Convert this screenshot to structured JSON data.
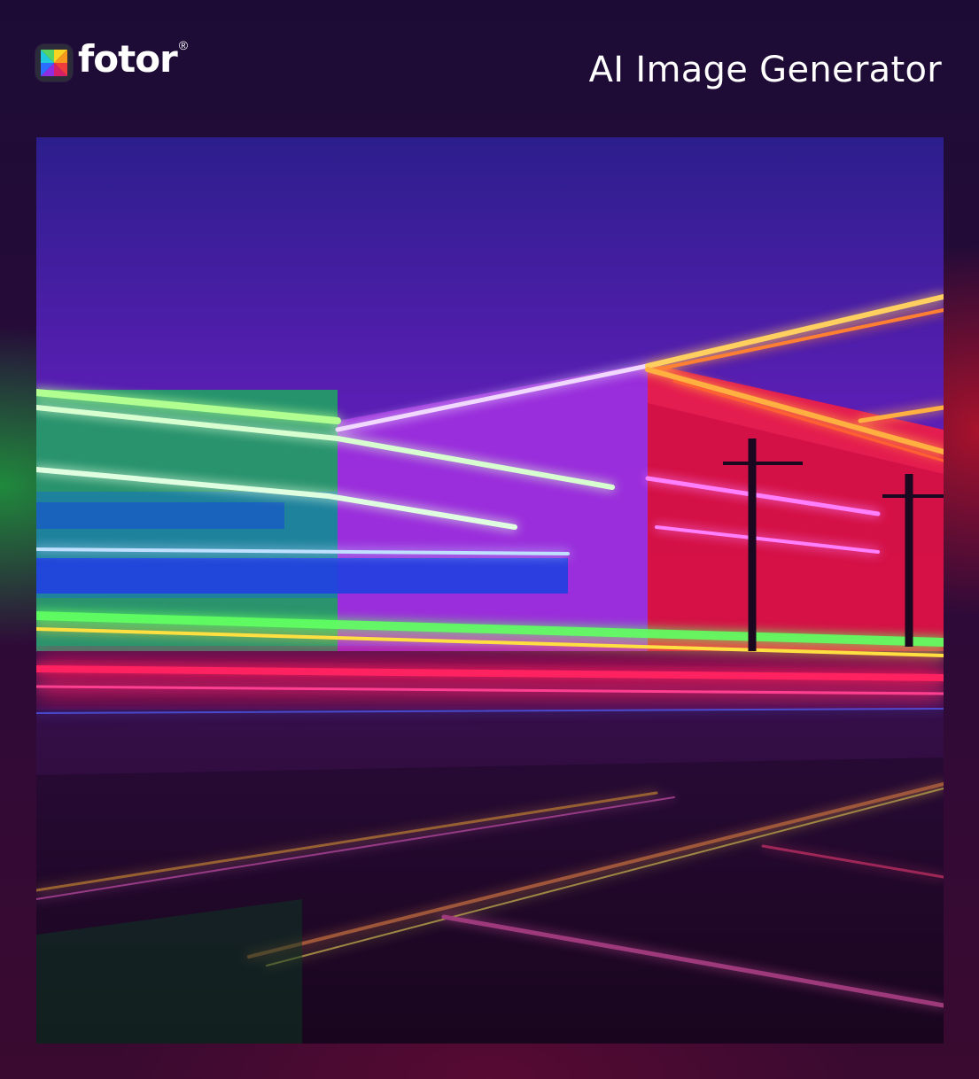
{
  "brand": {
    "name": "fotor",
    "registered_mark": "®",
    "icon": "fotor-logo-icon"
  },
  "header": {
    "title": "AI Image Generator"
  },
  "image": {
    "subject": "neon-lit building with light trails at night",
    "icon": "generated-image"
  },
  "colors": {
    "background": "#2a0a3a",
    "text": "#ffffff",
    "neon_green": "#3cff3c",
    "neon_purple": "#b040ff",
    "neon_red": "#ff2040",
    "neon_orange": "#ff9020"
  }
}
